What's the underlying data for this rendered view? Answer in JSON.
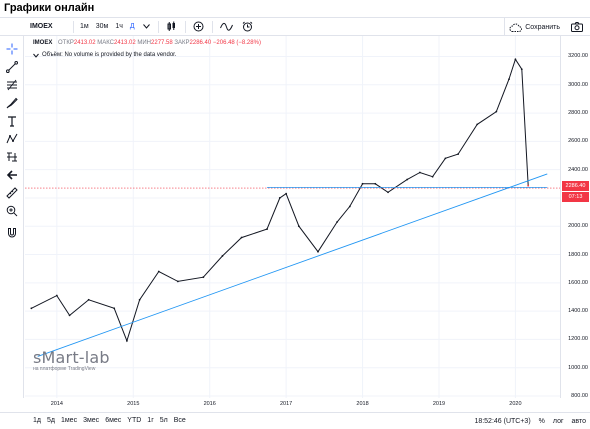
{
  "page": {
    "title": "Графики онлайн"
  },
  "toolbar": {
    "symbol": "IMOEX",
    "intervals": [
      "1м",
      "30м",
      "1ч",
      "Д"
    ],
    "active_interval": "Д",
    "save_label": "Сохранить"
  },
  "legend": {
    "symbol": "IMOEX",
    "open_label": "ОТКР",
    "open": "2413.02",
    "high_label": "МАКС",
    "high": "2413.02",
    "low_label": "МИН",
    "low": "2277.58",
    "close_label": "ЗАКР",
    "close": "2286.40",
    "change": "−206.48 (−8.28%)"
  },
  "notice": "Объём: No volume is provided by the data vendor.",
  "price_scale": {
    "ticks": [
      "3200.00",
      "3000.00",
      "2800.00",
      "2600.00",
      "2400.00",
      "2200.00",
      "2000.00",
      "1800.00",
      "1600.00",
      "1400.00",
      "1200.00",
      "1000.00",
      "800.00"
    ],
    "last_price": "2286.40",
    "countdown": "07:13"
  },
  "time_axis": {
    "ticks": [
      "2014",
      "2015",
      "2016",
      "2017",
      "2018",
      "2019",
      "2020"
    ]
  },
  "bottom": {
    "ranges": [
      "1д",
      "5д",
      "1мес",
      "3мес",
      "6мес",
      "YTD",
      "1г",
      "5л",
      "Все"
    ],
    "clock": "18:52:46 (UTC+3)",
    "percent": "%",
    "log": "лог",
    "auto": "авто"
  },
  "watermark": {
    "brand": "sMart-lab",
    "sub": "на платформе TradingView"
  },
  "colors": {
    "down": "#f23645",
    "up": "#131722",
    "trendline": "#2196f3",
    "level": "#f23645"
  },
  "chart_data": {
    "type": "line",
    "title": "IMOEX",
    "x": [
      "2013-09",
      "2014-01",
      "2014-03",
      "2014-06",
      "2014-10",
      "2014-12",
      "2015-02",
      "2015-05",
      "2015-08",
      "2015-12",
      "2016-03",
      "2016-06",
      "2016-10",
      "2016-12",
      "2017-01",
      "2017-03",
      "2017-06",
      "2017-09",
      "2017-11",
      "2018-01",
      "2018-03",
      "2018-05",
      "2018-08",
      "2018-10",
      "2018-12",
      "2019-02",
      "2019-04",
      "2019-07",
      "2019-10",
      "2019-12",
      "2020-01",
      "2020-02",
      "2020-03"
    ],
    "series": [
      {
        "values": [
          1420,
          1510,
          1370,
          1480,
          1420,
          1190,
          1480,
          1680,
          1610,
          1640,
          1790,
          1920,
          1980,
          2200,
          2230,
          2000,
          1820,
          2030,
          2140,
          2300,
          2300,
          2240,
          2330,
          2380,
          2350,
          2480,
          2510,
          2720,
          2810,
          3040,
          3180,
          3110,
          2286
        ]
      }
    ],
    "ylim": [
      800,
      3260
    ],
    "xlim": [
      "2013-08",
      "2020-08"
    ],
    "trendline": {
      "from": [
        "2013-10",
        1080
      ],
      "to": [
        "2020-06",
        2370
      ]
    },
    "horizontal_level": 2270
  }
}
